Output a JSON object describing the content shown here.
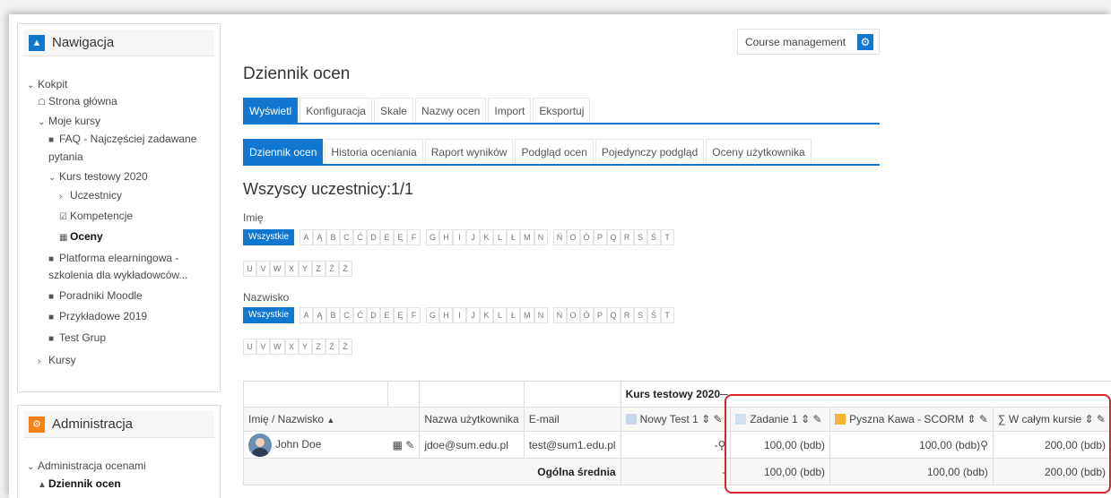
{
  "navigation": {
    "title": "Nawigacja",
    "items": [
      {
        "label": "Kokpit"
      },
      {
        "label": "Strona główna"
      },
      {
        "label": "Moje kursy"
      },
      {
        "label": "FAQ - Najczęściej zadawane"
      },
      {
        "label": "pytania"
      },
      {
        "label": "Kurs testowy 2020"
      },
      {
        "label": "Uczestnicy"
      },
      {
        "label": "Kompetencje"
      },
      {
        "label": "Oceny"
      },
      {
        "label": "Platforma elearningowa -"
      },
      {
        "label": "szkolenia dla wykładowców..."
      },
      {
        "label": "Poradniki Moodle"
      },
      {
        "label": "Przykładowe 2019"
      },
      {
        "label": "Test Grup"
      },
      {
        "label": "Kursy"
      }
    ]
  },
  "administration": {
    "title": "Administracja",
    "items": [
      {
        "label": "Administracja ocenami"
      },
      {
        "label": "Dziennik ocen"
      }
    ]
  },
  "course_management": {
    "label": "Course management"
  },
  "page_title": "Dziennik ocen",
  "tabs_primary": [
    "Wyświetl",
    "Konfiguracja",
    "Skale",
    "Nazwy ocen",
    "Import",
    "Eksportuj"
  ],
  "tabs_secondary": [
    "Dziennik ocen",
    "Historia oceniania",
    "Raport wyników",
    "Podgląd ocen",
    "Pojedynczy podgląd",
    "Oceny użytkownika"
  ],
  "participants": "Wszyscy uczestnicy:1/1",
  "filters": {
    "first_name_label": "Imię",
    "last_name_label": "Nazwisko",
    "all_label": "Wszystkie",
    "letters_row1": [
      "A",
      "Ą",
      "B",
      "C",
      "Ć",
      "D",
      "E",
      "Ę",
      "F",
      "G",
      "H",
      "I",
      "J",
      "K",
      "L",
      "Ł",
      "M",
      "N",
      "Ń",
      "O",
      "Ó",
      "P",
      "Q",
      "R",
      "S",
      "Ś",
      "T"
    ],
    "letters_row2": [
      "U",
      "V",
      "W",
      "X",
      "Y",
      "Z",
      "Ź",
      "Ż"
    ]
  },
  "grade_table": {
    "category": "Kurs testowy 2020",
    "headers": {
      "name": "Imię / Nazwisko",
      "username": "Nazwa użytkownika",
      "email": "E-mail",
      "item1": "Nowy Test 1",
      "item2": "Zadanie 1",
      "item3": "Pyszna Kawa - SCORM",
      "total": "W całym kursie"
    },
    "row": {
      "name": "John Doe",
      "username": "jdoe@sum.edu.pl",
      "email": "test@sum1.edu.pl",
      "item1": "-",
      "item2": "100,00 (bdb)",
      "item3": "100,00 (bdb)",
      "total": "200,00 (bdb)"
    },
    "average": {
      "label": "Ogólna średnia",
      "item1": "-",
      "item2": "100,00 (bdb)",
      "item3": "100,00 (bdb)",
      "total": "200,00 (bdb)"
    }
  },
  "colors": {
    "accent": "#1177d1",
    "admin_icon": "#f98012",
    "highlight": "#d7252b"
  }
}
